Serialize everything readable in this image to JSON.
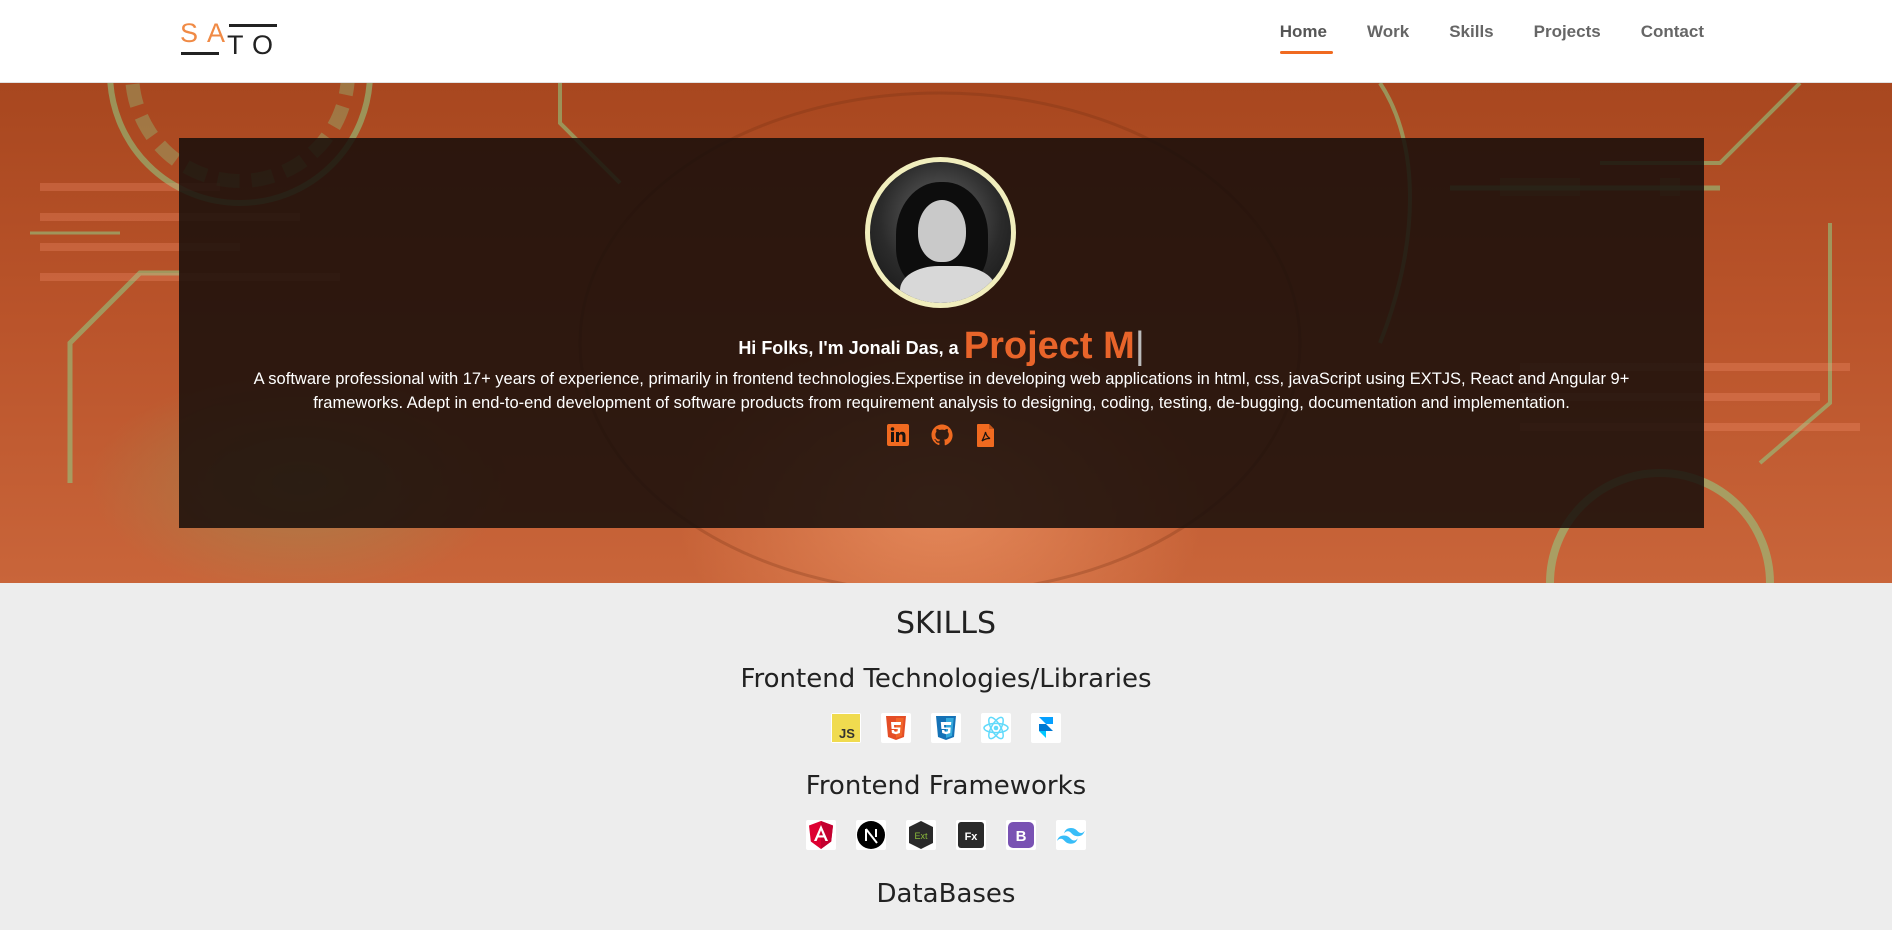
{
  "logo": {
    "top": "SA",
    "bottom": "TO"
  },
  "nav": {
    "items": [
      {
        "label": "Home",
        "active": true
      },
      {
        "label": "Work",
        "active": false
      },
      {
        "label": "Skills",
        "active": false
      },
      {
        "label": "Projects",
        "active": false
      },
      {
        "label": "Contact",
        "active": false
      }
    ]
  },
  "hero": {
    "greeting": "Hi Folks, I'm Jonali Das, a",
    "typed_text": "Project M",
    "cursor": "|",
    "bio": "A software professional with 17+ years of experience, primarily in frontend technologies.Expertise in developing web applications in html, css, javaScript using EXTJS, React and Angular 9+ frameworks. Adept in end-to-end development of software products from requirement analysis to designing, coding, testing, de-bugging, documentation and implementation.",
    "socials": [
      {
        "icon": "linkedin-icon"
      },
      {
        "icon": "github-icon"
      },
      {
        "icon": "pdf-icon"
      }
    ],
    "accent_color": "#e8642a"
  },
  "skills": {
    "title": "SKILLS",
    "frontend_libraries": {
      "title": "Frontend Technologies/Libraries",
      "icons": [
        "javascript-icon",
        "html5-icon",
        "css3-icon",
        "react-icon",
        "framer-icon"
      ]
    },
    "frontend_frameworks": {
      "title": "Frontend Frameworks",
      "icons": [
        "angular-icon",
        "nextjs-icon",
        "extjs-icon",
        "flex-icon",
        "bootstrap-icon",
        "tailwind-icon"
      ]
    },
    "databases": {
      "title": "DataBases"
    }
  },
  "colors": {
    "nav_active_underline": "#f06a20",
    "logo_orange": "#f08a45",
    "skills_bg": "#ededed"
  }
}
